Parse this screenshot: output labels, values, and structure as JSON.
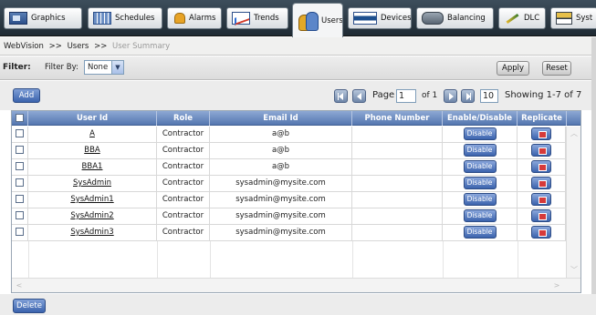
{
  "tabs": [
    {
      "label": "Graphics",
      "icon": "graphics-icon"
    },
    {
      "label": "Schedules",
      "icon": "calendar-icon"
    },
    {
      "label": "Alarms",
      "icon": "bell-icon"
    },
    {
      "label": "Trends",
      "icon": "trend-chart-icon"
    },
    {
      "label": "Users",
      "icon": "users-icon",
      "active": true
    },
    {
      "label": "Devices",
      "icon": "devices-icon"
    },
    {
      "label": "Balancing",
      "icon": "balancing-icon"
    },
    {
      "label": "DLC",
      "icon": "dlc-icon"
    },
    {
      "label": "Syst",
      "icon": "system-icon"
    }
  ],
  "breadcrumb": {
    "root": "WebVision",
    "sep1": ">>",
    "section": "Users",
    "sep2": ">>",
    "current": "User Summary"
  },
  "filter": {
    "label": "Filter:",
    "filter_by_label": "Filter By:",
    "selected": "None",
    "apply_label": "Apply",
    "reset_label": "Reset"
  },
  "toolbar": {
    "add_label": "Add",
    "page_label": "Page",
    "page_value": "1",
    "of_label": "of 1",
    "page_size": "10",
    "showing": "Showing 1-7 of 7"
  },
  "table": {
    "columns": [
      "User Id",
      "Role",
      "Email Id",
      "Phone Number",
      "Enable/Disable",
      "Replicate"
    ],
    "rows": [
      {
        "user_id": "A",
        "role": "Contractor",
        "email": "a@b",
        "phone": "",
        "action": "Disable"
      },
      {
        "user_id": "BBA",
        "role": "Contractor",
        "email": "a@b",
        "phone": "",
        "action": "Disable"
      },
      {
        "user_id": "BBA1",
        "role": "Contractor",
        "email": "a@b",
        "phone": "",
        "action": "Disable"
      },
      {
        "user_id": "SysAdmin",
        "role": "Contractor",
        "email": "sysadmin@mysite.com",
        "phone": "",
        "action": "Disable"
      },
      {
        "user_id": "SysAdmin1",
        "role": "Contractor",
        "email": "sysadmin@mysite.com",
        "phone": "",
        "action": "Disable"
      },
      {
        "user_id": "SysAdmin2",
        "role": "Contractor",
        "email": "sysadmin@mysite.com",
        "phone": "",
        "action": "Disable"
      },
      {
        "user_id": "SysAdmin3",
        "role": "Contractor",
        "email": "sysadmin@mysite.com",
        "phone": "",
        "action": "Disable"
      }
    ]
  },
  "bottom": {
    "delete_label": "Delete"
  },
  "colors": {
    "accent_blue": "#3b63ad",
    "header_blue": "#5577b0",
    "tabbar_dark": "#1f2a33"
  }
}
